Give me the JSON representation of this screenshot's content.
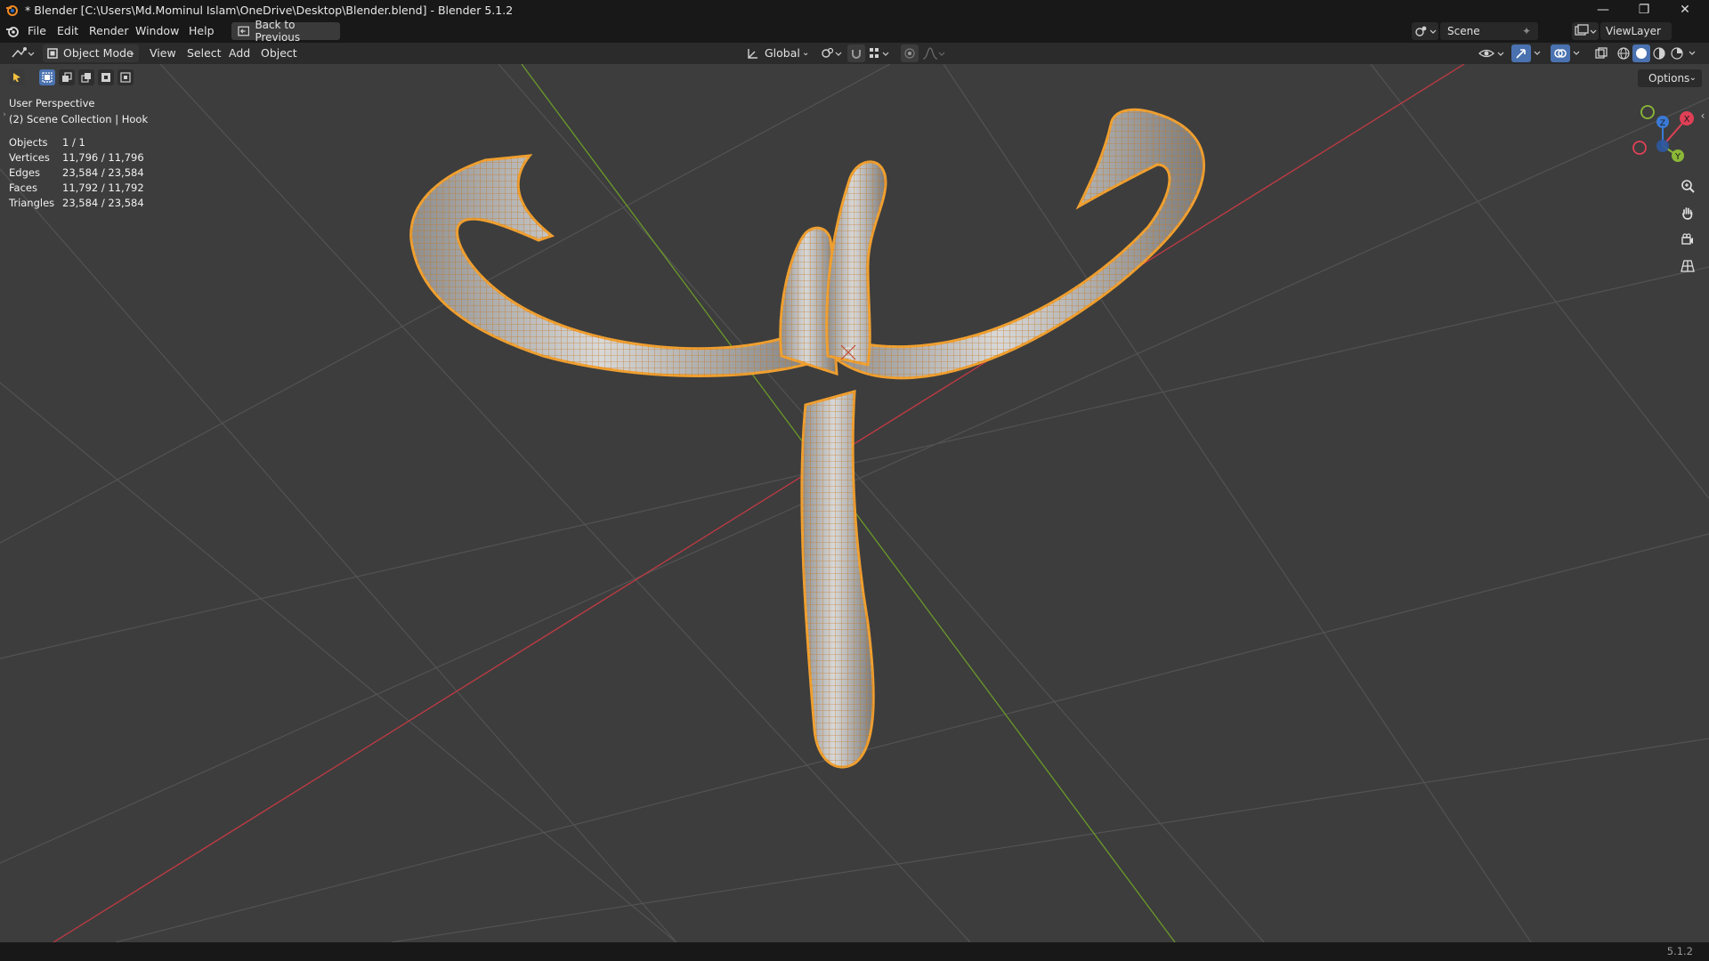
{
  "window": {
    "title": "* Blender [C:\\Users\\Md.Mominul Islam\\OneDrive\\Desktop\\Blender.blend] - Blender 5.1.2",
    "controls": [
      "minimize-icon",
      "restore-icon",
      "close-icon"
    ]
  },
  "menubar": {
    "items": [
      "File",
      "Edit",
      "Render",
      "Window",
      "Help"
    ],
    "back_button": "Back to Previous",
    "scene": "Scene",
    "view_layer": "ViewLayer"
  },
  "header": {
    "mode": "Object Mode",
    "menus": [
      "View",
      "Select",
      "Add",
      "Object"
    ],
    "transform_orientation": "Global"
  },
  "viewport": {
    "view_name": "User Perspective",
    "collection": "(2) Scene Collection | Hook",
    "options_label": "Options",
    "stats": [
      {
        "label": "Objects",
        "value": "1 / 1"
      },
      {
        "label": "Vertices",
        "value": "11,796 / 11,796"
      },
      {
        "label": "Edges",
        "value": "23,584 / 23,584"
      },
      {
        "label": "Faces",
        "value": "11,792 / 11,792"
      },
      {
        "label": "Triangles",
        "value": "23,584 / 23,584"
      }
    ],
    "gizmo_axes": [
      "X",
      "Y",
      "Z"
    ],
    "colors": {
      "background": "#3d3d3d",
      "grid": "#535353",
      "x_axis": "#c23a44",
      "y_axis": "#6a9a2a",
      "selection_outline": "#f0a030",
      "gizmo_x": "#e04056",
      "gizmo_y": "#8cb838",
      "gizmo_z": "#3a7ad6"
    }
  },
  "statusbar": {
    "version": "5.1.2"
  }
}
